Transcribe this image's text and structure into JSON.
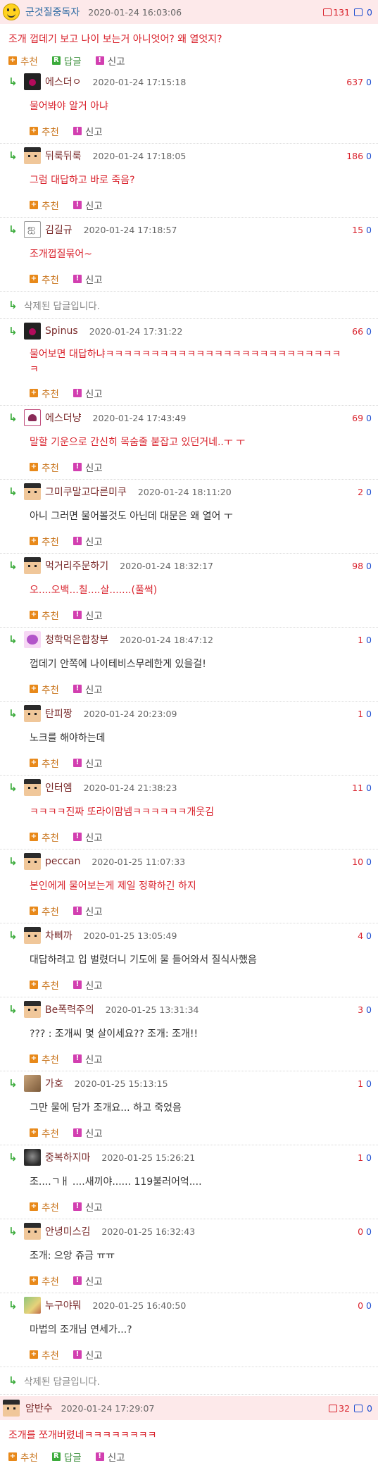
{
  "post1": {
    "nick": "군것질중독자",
    "date": "2020-01-24 16:03:06",
    "up": "131",
    "down": "0",
    "title": "조개 껍데기 보고 나이 보는거 아니엇어? 왜 열엇지?",
    "actions": {
      "recommend": "추천",
      "reply": "답글",
      "report": "신고"
    }
  },
  "comments": [
    {
      "nick": "에스더ㅇ",
      "date": "2020-01-24 17:15:18",
      "up": "637",
      "down": "0",
      "text": "물어봐야 알거 아냐",
      "avatar": "dark",
      "red": true
    },
    {
      "nick": "뒤룩뒤룩",
      "date": "2020-01-24 17:18:05",
      "up": "186",
      "down": "0",
      "text": "그럼 대답하고 바로 죽음?",
      "avatar": "block",
      "red": true
    },
    {
      "nick": "김길규",
      "date": "2020-01-24 17:18:57",
      "up": "15",
      "down": "0",
      "text": "조개껍질묶어~",
      "avatar": "sketch",
      "red": true
    },
    {
      "deleted": "삭제된 답글입니다."
    },
    {
      "nick": "Spinus",
      "date": "2020-01-24 17:31:22",
      "up": "66",
      "down": "0",
      "text": "물어보면 대답하냐ㅋㅋㅋㅋㅋㅋㅋㅋㅋㅋㅋㅋㅋㅋㅋㅋㅋㅋㅋㅋㅋㅋㅋㅋㅋㅋㅋ",
      "avatar": "dark",
      "red": true,
      "tall": true
    },
    {
      "nick": "에스더냥",
      "date": "2020-01-24 17:43:49",
      "up": "69",
      "down": "0",
      "text": "말할 기운으로 간신히 목숨줄 붙잡고 있던거네..ㅜ ㅜ",
      "avatar": "pinkbox",
      "red": true
    },
    {
      "nick": "그미쿠말고다른미쿠",
      "date": "2020-01-24 18:11:20",
      "up": "2",
      "down": "0",
      "text": "아니 그러면 물어볼것도 아닌데 대문은 왜 열어 ㅜ",
      "avatar": "block",
      "red": false
    },
    {
      "nick": "먹거리주문하기",
      "date": "2020-01-24 18:32:17",
      "up": "98",
      "down": "0",
      "text": "오....오백...칠....살.......(풀썩)",
      "avatar": "block",
      "red": true
    },
    {
      "nick": "청학먹은합창부",
      "date": "2020-01-24 18:47:12",
      "up": "1",
      "down": "0",
      "text": "껍데기 안쪽에 나이테비스무레한게 있을걸!",
      "avatar": "purple",
      "red": false
    },
    {
      "nick": "탄피짱",
      "date": "2020-01-24 20:23:09",
      "up": "1",
      "down": "0",
      "text": "노크를 해야하는데",
      "avatar": "block",
      "red": false
    },
    {
      "nick": "인터엠",
      "date": "2020-01-24 21:38:23",
      "up": "11",
      "down": "0",
      "text": "ㅋㅋㅋㅋ진짜 또라이맘넴ㅋㅋㅋㅋㅋㅋ개웃김",
      "avatar": "block",
      "red": true
    },
    {
      "nick": "peccan",
      "date": "2020-01-25 11:07:33",
      "up": "10",
      "down": "0",
      "text": "본인에게 물어보는게 제일 정확하긴 하지",
      "avatar": "block",
      "red": true
    },
    {
      "nick": "차삐까",
      "date": "2020-01-25 13:05:49",
      "up": "4",
      "down": "0",
      "text": "대답하려고 입 벌렸더니 기도에 물 들어와서 질식사했음",
      "avatar": "block",
      "red": false
    },
    {
      "nick": "Be폭력주의",
      "date": "2020-01-25 13:31:34",
      "up": "3",
      "down": "0",
      "text": "??? : 조개씨 몇 살이세요?? 조개: 조개!!",
      "avatar": "block",
      "red": false
    },
    {
      "nick": "가호",
      "date": "2020-01-25 15:13:15",
      "up": "1",
      "down": "0",
      "text": "그만 물에 담가 조개요... 하고 죽었음",
      "avatar": "photo1",
      "red": false
    },
    {
      "nick": "중복하지마",
      "date": "2020-01-25 15:26:21",
      "up": "1",
      "down": "0",
      "text": "조....ㄱㅐ ....새끼야...... 119불러어억....",
      "avatar": "photo2",
      "red": false
    },
    {
      "nick": "안녕미스김",
      "date": "2020-01-25 16:32:43",
      "up": "0",
      "down": "0",
      "text": "조개: 으앙 쥬금 ㅠㅠ",
      "avatar": "block",
      "red": false
    },
    {
      "nick": "누구야뭐",
      "date": "2020-01-25 16:40:50",
      "up": "0",
      "down": "0",
      "text": "마법의 조개님 연세가...?",
      "avatar": "photo3",
      "red": false
    },
    {
      "deleted": "삭제된 답글입니다."
    }
  ],
  "post2": {
    "nick": "암반수",
    "date": "2020-01-24 17:29:07",
    "up": "32",
    "down": "0",
    "title": "조개를 쪼개버렸네ㅋㅋㅋㅋㅋㅋㅋㅋ",
    "actions": {
      "recommend": "추천",
      "reply": "답글",
      "report": "신고"
    }
  },
  "comment_actions": {
    "recommend": "추천",
    "report": "신고"
  }
}
